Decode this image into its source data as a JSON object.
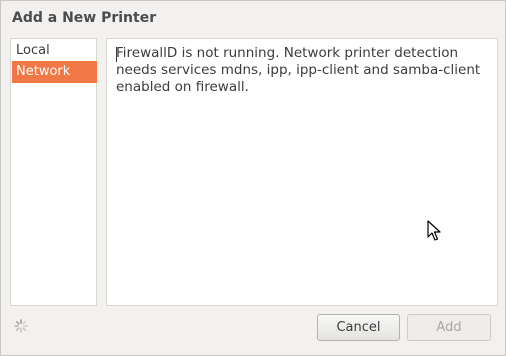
{
  "dialog": {
    "title": "Add a New Printer"
  },
  "sidebar": {
    "items": [
      {
        "label": "Local",
        "selected": false
      },
      {
        "label": "Network",
        "selected": true
      }
    ]
  },
  "content": {
    "message_line1": "FirewallD is not running. Network printer detection",
    "message_line2": "needs services mdns, ipp, ipp-client and samba-client",
    "message_line3": "enabled on firewall."
  },
  "buttons": {
    "cancel_label": "Cancel",
    "add_label": "Add"
  },
  "colors": {
    "selection": "#f07746",
    "background": "#f2f1f0"
  },
  "icons": {
    "spinner": "spinner-icon",
    "cursor": "mouse-cursor-icon"
  }
}
